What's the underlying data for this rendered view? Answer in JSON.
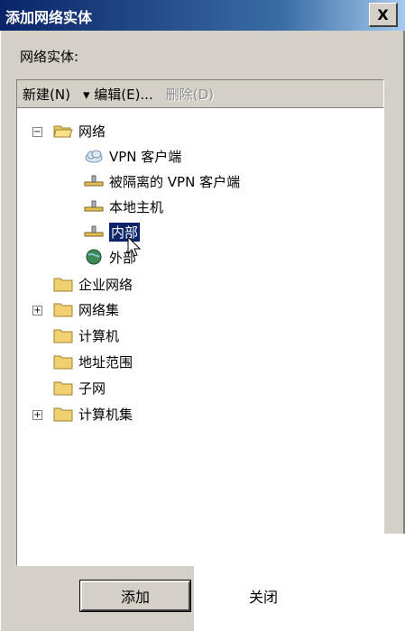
{
  "window": {
    "title": "添加网络实体",
    "close_label": "X"
  },
  "label": "网络实体:",
  "toolbar": {
    "new_label": "新建(N)",
    "edit_label": "▾ 编辑(E)...",
    "delete_label": "删除(D)"
  },
  "tree": {
    "root": "网络",
    "children": [
      "VPN 客户端",
      "被隔离的 VPN 客户端",
      "本地主机",
      "内部",
      "外部"
    ],
    "selected": "内部",
    "folders": [
      "企业网络",
      "网络集",
      "计算机",
      "地址范围",
      "子网",
      "计算机集"
    ]
  },
  "buttons": {
    "add_label": "添加",
    "close_label": "关闭"
  },
  "colors": {
    "titlebar": "#0a246a",
    "selection": "#0a246a",
    "dialog_bg": "#d4d0c8"
  }
}
